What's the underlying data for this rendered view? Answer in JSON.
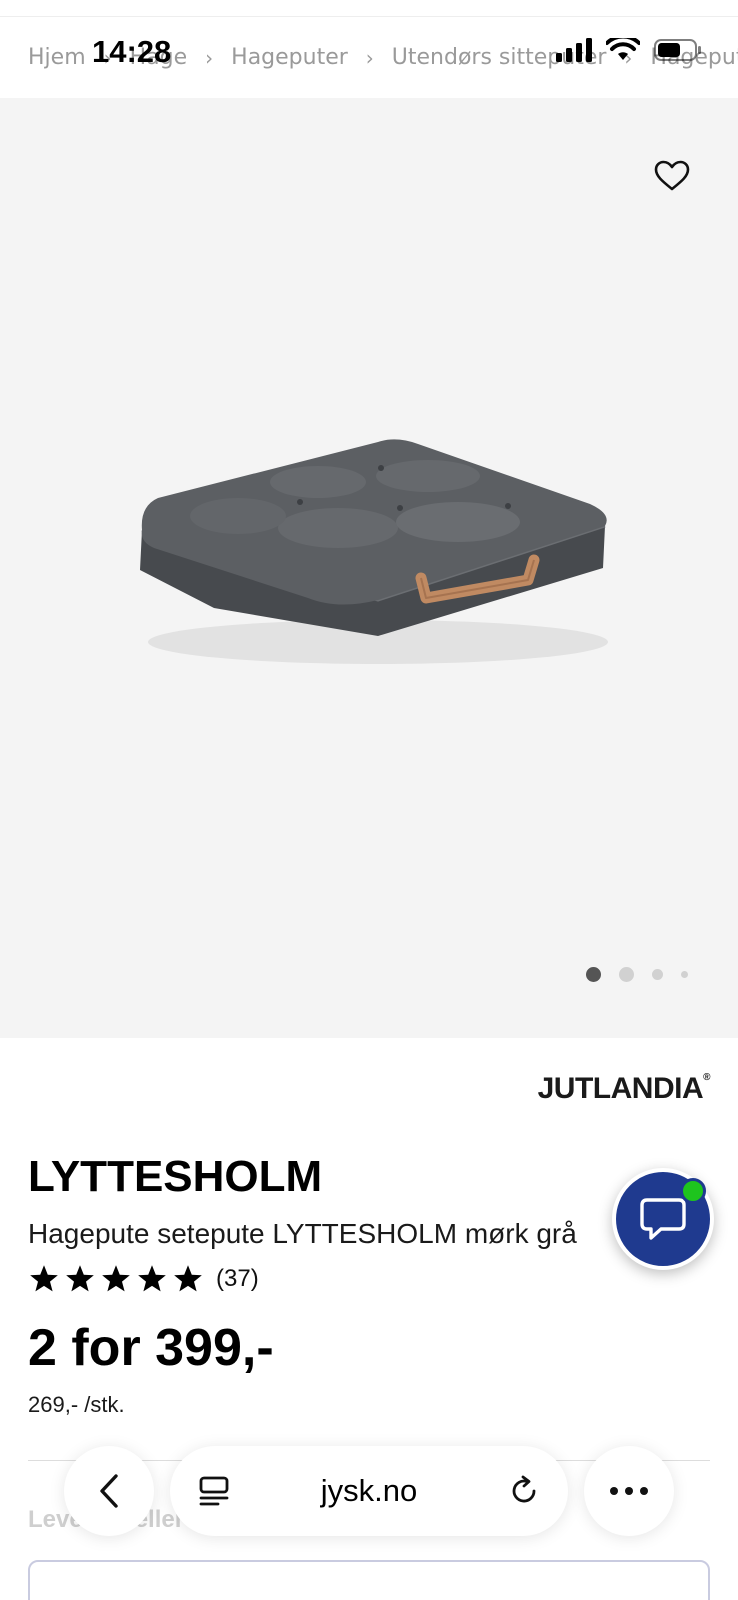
{
  "status": {
    "time": "14:28"
  },
  "breadcrumb": {
    "items": [
      "Hjem",
      "Hage",
      "Hageputer",
      "Utendørs sitteputer",
      "Hagepute"
    ],
    "separator": "›"
  },
  "gallery": {
    "favorite_icon": "heart-outline-icon",
    "image_alt": "Grey tufted floor cushion with brown leather handle",
    "slide_count": 4,
    "active_slide": 1
  },
  "product": {
    "brand": "JUTLANDIA",
    "brand_mark": "®",
    "name": "LYTTESHOLM",
    "description": "Hagepute setepute LYTTESHOLM mørk grå",
    "rating": {
      "stars": 5,
      "count_label": "(37)"
    },
    "price_offer": "2 for 399,-",
    "unit_price": "269,- /stk.",
    "delivery_heading": "Levering eller opphenting"
  },
  "browser": {
    "url": "jysk.no",
    "back_icon": "chevron-left-icon",
    "tabs_icon": "tabs-list-icon",
    "reload_icon": "reload-icon",
    "more_icon": "more-horizontal-icon"
  },
  "chat": {
    "icon": "chat-bubble-icon",
    "online": true
  },
  "colors": {
    "chat_bg": "#1f3a8f",
    "online_dot": "#1ec41e",
    "gallery_bg": "#f4f4f4",
    "breadcrumb_text": "#9a9a9a"
  }
}
